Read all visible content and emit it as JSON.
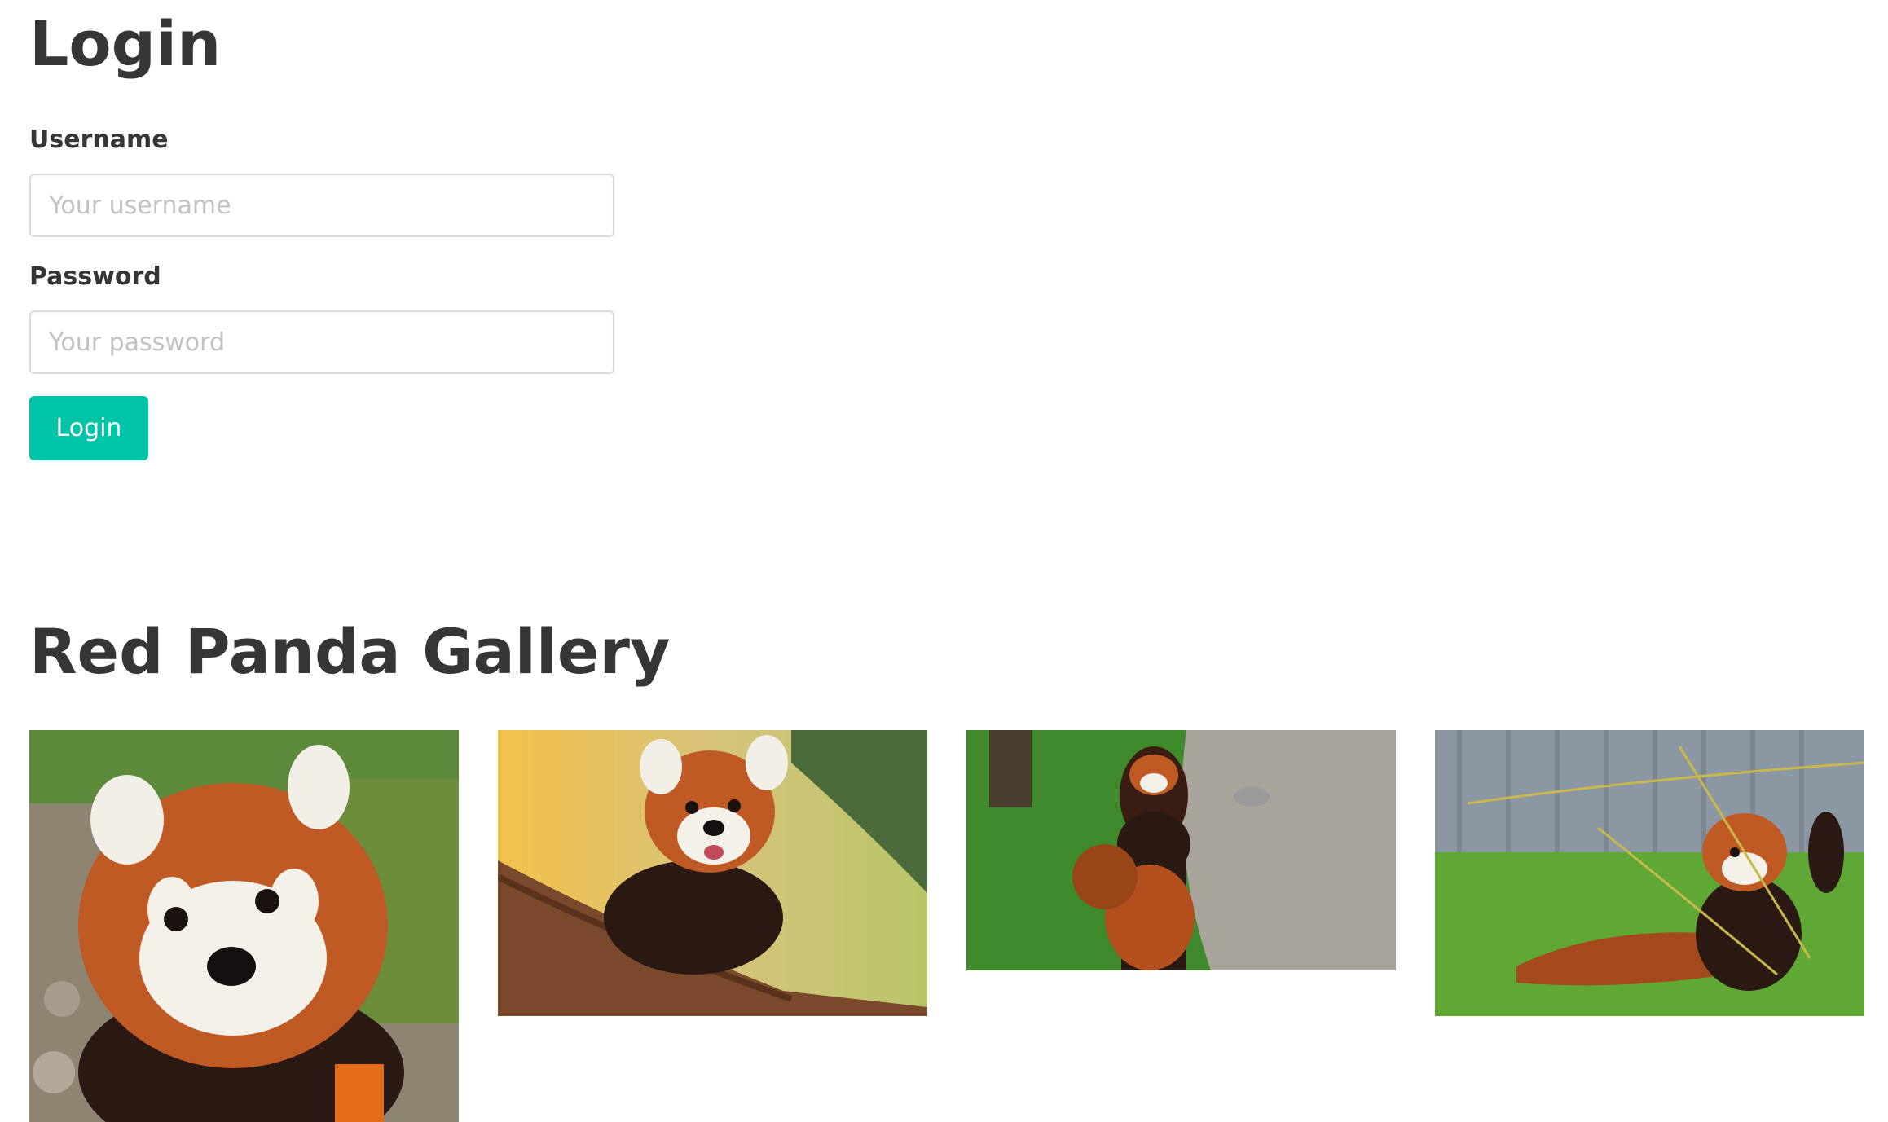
{
  "login": {
    "title": "Login",
    "username_label": "Username",
    "username_placeholder": "Your username",
    "password_label": "Password",
    "password_placeholder": "Your password",
    "button_label": "Login"
  },
  "gallery": {
    "title": "Red Panda Gallery",
    "images": [
      {
        "subject": "red panda close-up standing, looking at camera"
      },
      {
        "subject": "red panda walking on tree branch"
      },
      {
        "subject": "two red pandas standing with raised arms on path"
      },
      {
        "subject": "red panda sitting in grass with bamboo"
      }
    ]
  },
  "colors": {
    "accent": "#00c4a7",
    "text": "#363636",
    "input_border": "#dbdbdb",
    "placeholder": "#c2c2c2"
  }
}
